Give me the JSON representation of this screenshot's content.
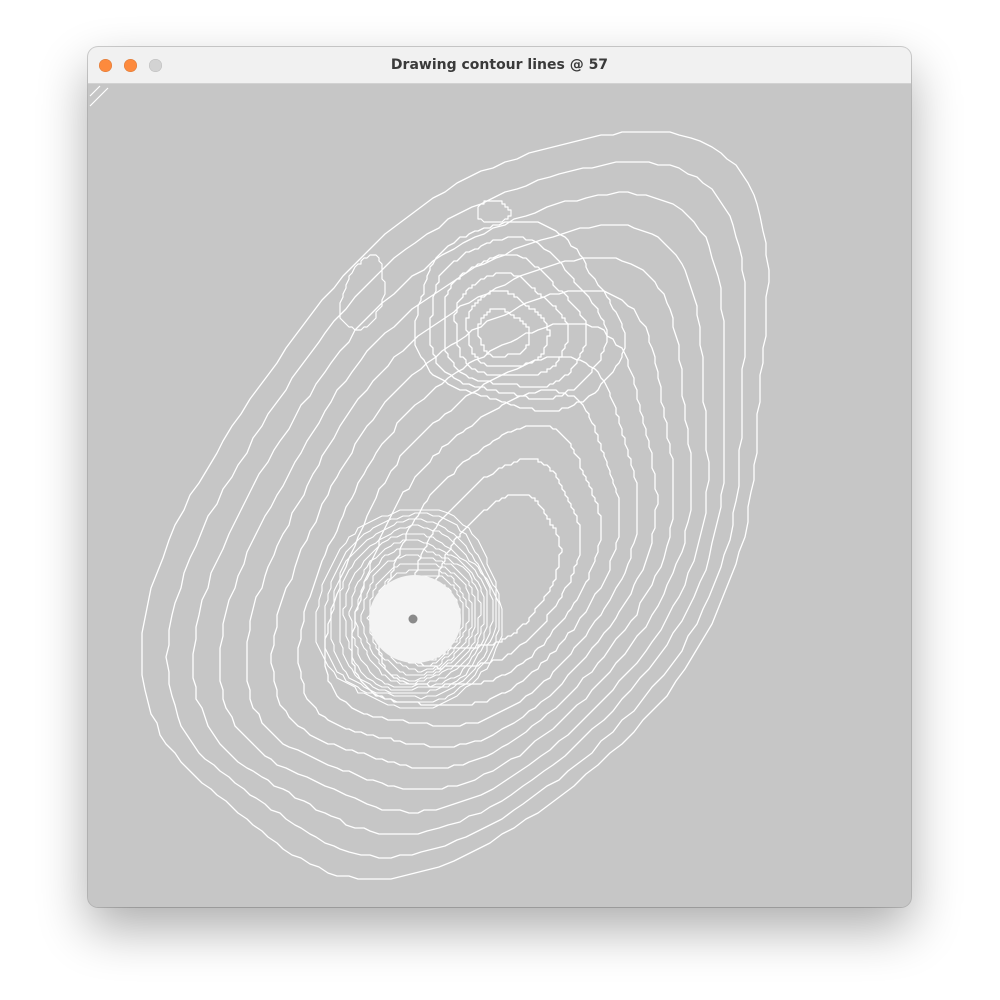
{
  "window": {
    "title": "Drawing contour lines @ 57",
    "controls": [
      "close-button",
      "minimize-button",
      "zoom-button"
    ]
  },
  "canvas": {
    "background": "#c6c6c6",
    "line_color": "#ffffff",
    "peak_fill": "#f4f4f4"
  }
}
